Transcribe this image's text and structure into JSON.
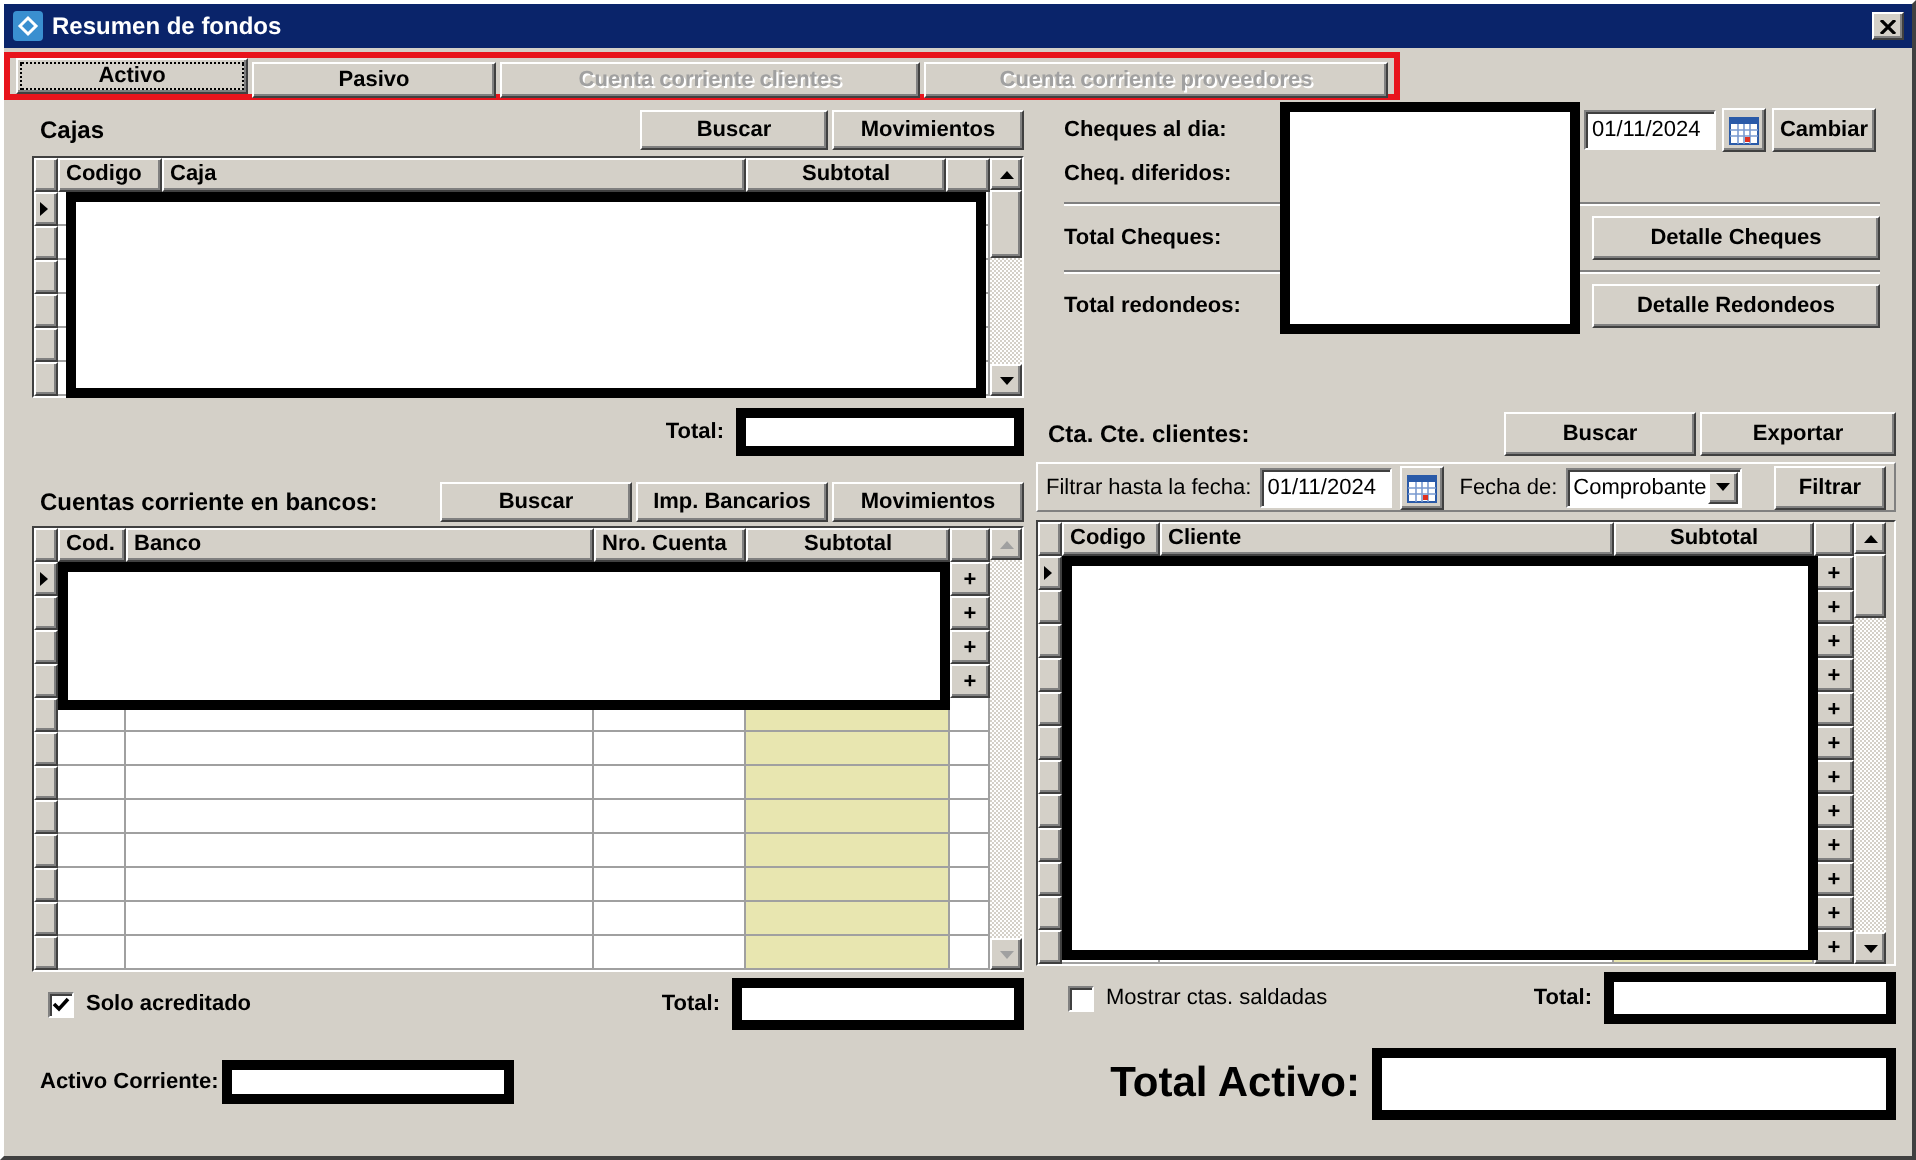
{
  "window": {
    "title": "Resumen de fondos"
  },
  "tabs": [
    {
      "label": "Activo",
      "selected": true,
      "disabled": false
    },
    {
      "label": "Pasivo",
      "selected": false,
      "disabled": false
    },
    {
      "label": "Cuenta corriente clientes",
      "selected": false,
      "disabled": true
    },
    {
      "label": "Cuenta corriente proveedores",
      "selected": false,
      "disabled": true
    }
  ],
  "cajas": {
    "title": "Cajas",
    "buttons": [
      "Buscar",
      "Movimientos"
    ],
    "columns": [
      "Codigo",
      "Caja",
      "Subtotal"
    ],
    "rows": [
      {
        "current": true
      },
      {
        "current": false
      },
      {
        "current": false
      },
      {
        "current": false
      },
      {
        "current": false
      },
      {
        "current": false
      }
    ],
    "total_label": "Total:"
  },
  "bancos": {
    "title": "Cuentas corriente en bancos:",
    "buttons": [
      "Buscar",
      "Imp. Bancarios",
      "Movimientos"
    ],
    "columns": [
      "Cod.",
      "Banco",
      "Nro. Cuenta",
      "Subtotal"
    ],
    "rows": [
      {
        "current": true,
        "action": "+"
      },
      {
        "current": false,
        "action": "+"
      },
      {
        "current": false,
        "action": "+"
      },
      {
        "current": false,
        "action": "+"
      },
      {
        "current": false
      },
      {
        "current": false
      },
      {
        "current": false
      },
      {
        "current": false
      },
      {
        "current": false
      },
      {
        "current": false
      },
      {
        "current": false
      },
      {
        "current": false
      }
    ],
    "only_credited": {
      "label": "Solo acreditado",
      "checked": true
    },
    "total_label": "Total:"
  },
  "activo_corriente": {
    "label": "Activo Corriente:"
  },
  "cheques": {
    "date": "01/11/2024",
    "change_button": "Cambiar",
    "rows": [
      {
        "label": "Cheques al dia:"
      },
      {
        "label": "Cheq. diferidos:"
      },
      {
        "label": "Total Cheques:",
        "button": "Detalle Cheques"
      },
      {
        "label": "Total redondeos:",
        "button": "Detalle Redondeos"
      }
    ]
  },
  "clientes": {
    "title": "Cta. Cte. clientes:",
    "buttons": [
      "Buscar",
      "Exportar"
    ],
    "filter": {
      "label": "Filtrar hasta la fecha:",
      "date": "01/11/2024",
      "date_type_label": "Fecha de:",
      "date_type": "Comprobante",
      "button": "Filtrar"
    },
    "columns": [
      "Codigo",
      "Cliente",
      "Subtotal"
    ],
    "rows": [
      {
        "current": true,
        "action": "+"
      },
      {
        "current": false,
        "action": "+"
      },
      {
        "current": false,
        "action": "+"
      },
      {
        "current": false,
        "action": "+"
      },
      {
        "current": false,
        "action": "+"
      },
      {
        "current": false,
        "action": "+"
      },
      {
        "current": false,
        "action": "+"
      },
      {
        "current": false,
        "action": "+"
      },
      {
        "current": false,
        "action": "+"
      },
      {
        "current": false,
        "action": "+"
      },
      {
        "current": false,
        "action": "+"
      },
      {
        "current": false,
        "action": "+"
      }
    ],
    "show_settled": {
      "label": "Mostrar ctas. saldadas",
      "checked": false
    },
    "total_label": "Total:"
  },
  "total_activo": {
    "label": "Total Activo:"
  }
}
